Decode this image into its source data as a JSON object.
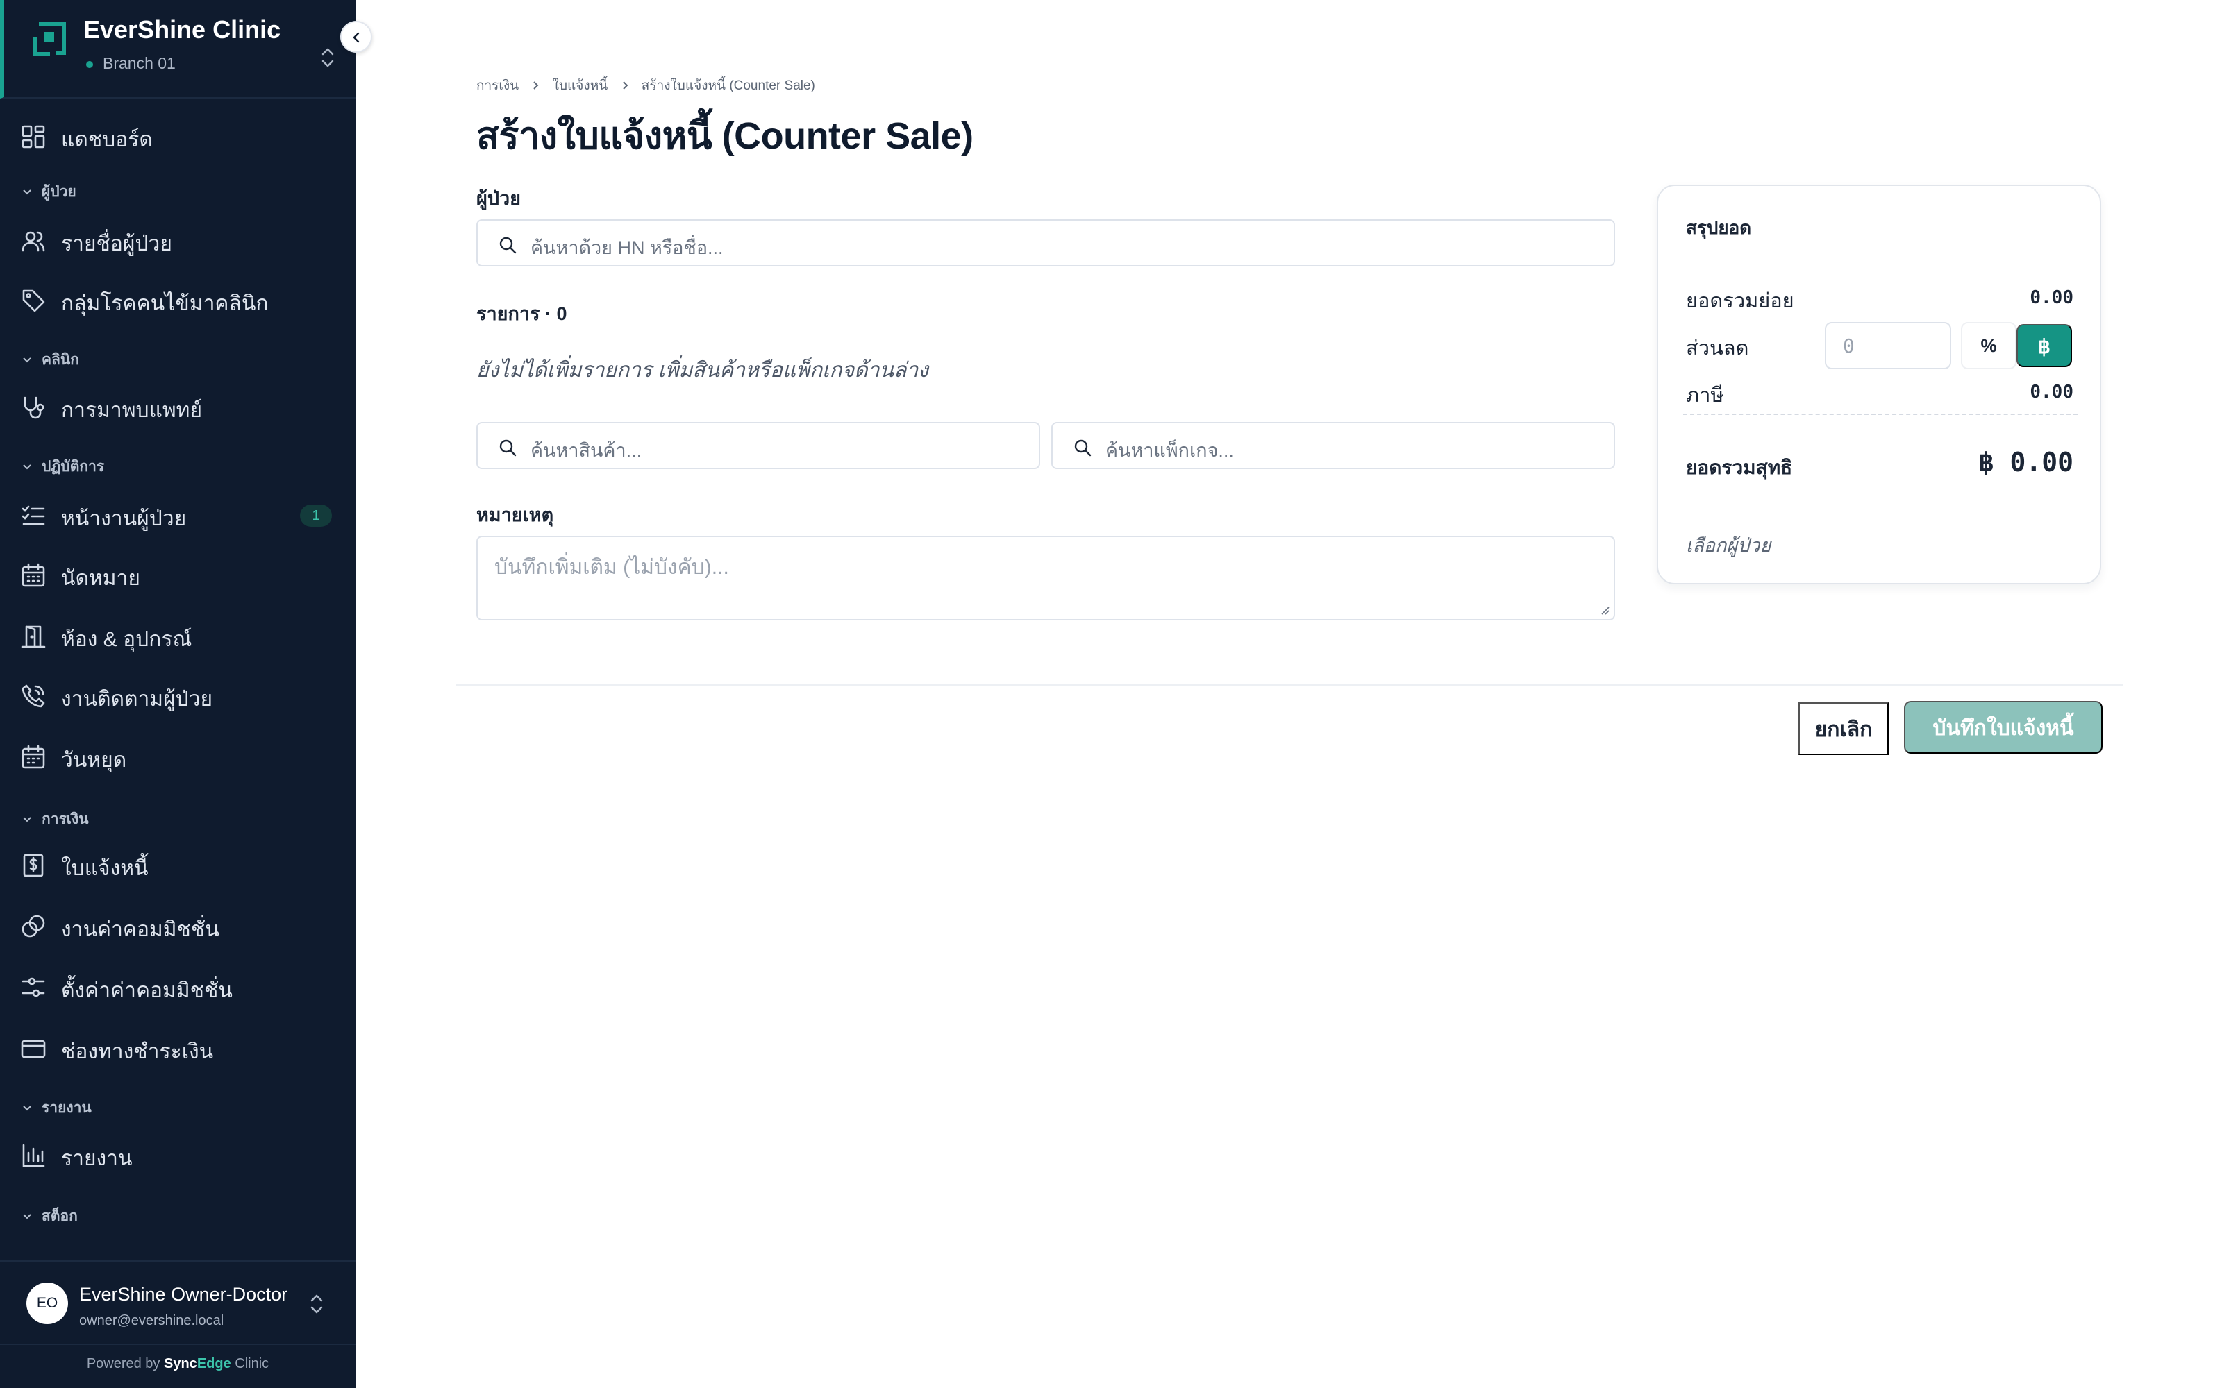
{
  "sidebar": {
    "brand": {
      "name": "EverShine Clinic",
      "branch": "Branch 01"
    },
    "items": [
      {
        "label": "แดชบอร์ด",
        "icon": "dashboard-grid-icon"
      },
      {
        "label": "รายชื่อผู้ป่วย",
        "icon": "users-icon"
      },
      {
        "label": "กลุ่มโรคคนไข้มาคลินิก",
        "icon": "tag-icon"
      },
      {
        "label": "การมาพบแพทย์",
        "icon": "stethoscope-icon"
      },
      {
        "label": "หน้างานผู้ป่วย",
        "icon": "list-checks-icon",
        "badge": "1"
      },
      {
        "label": "นัดหมาย",
        "icon": "calendar-icon"
      },
      {
        "label": "ห้อง & อุปกรณ์",
        "icon": "door-icon"
      },
      {
        "label": "งานติดตามผู้ป่วย",
        "icon": "phone-icon"
      },
      {
        "label": "วันหยุด",
        "icon": "calendar-days-icon"
      },
      {
        "label": "ใบแจ้งหนี้",
        "icon": "receipt-icon"
      },
      {
        "label": "งานค่าคอมมิชชั่น",
        "icon": "coins-icon"
      },
      {
        "label": "ตั้งค่าค่าคอมมิชชั่น",
        "icon": "sliders-icon"
      },
      {
        "label": "ช่องทางชำระเงิน",
        "icon": "credit-card-icon"
      },
      {
        "label": "รายงาน",
        "icon": "bar-chart-icon"
      }
    ],
    "sections": [
      "ผู้ป่วย",
      "คลินิก",
      "ปฏิบัติการ",
      "การเงิน",
      "รายงาน",
      "สต็อก"
    ],
    "user": {
      "initials": "EO",
      "name": "EverShine Owner-Doctor",
      "email": "owner@evershine.local"
    },
    "powered": {
      "prefix": "Powered by",
      "brand_a": "Sync",
      "brand_b": "Edge",
      "suffix": "Clinic"
    }
  },
  "main": {
    "breadcrumb": [
      "การเงิน",
      "ใบแจ้งหนี้",
      "สร้างใบแจ้งหนี้ (Counter Sale)"
    ],
    "title": "สร้างใบแจ้งหนี้ (Counter Sale)",
    "patient_label": "ผู้ป่วย",
    "patient_search_placeholder": "ค้นหาด้วย HN หรือชื่อ...",
    "items_label": "รายการ · 0",
    "empty_message": "ยังไม่ได้เพิ่มรายการ เพิ่มสินค้าหรือแพ็กเกจด้านล่าง",
    "product_search_placeholder": "ค้นหาสินค้า...",
    "package_search_placeholder": "ค้นหาแพ็กเกจ...",
    "notes_label": "หมายเหตุ",
    "notes_placeholder": "บันทึกเพิ่มเติม (ไม่บังคับ)..."
  },
  "summary": {
    "title": "สรุปยอด",
    "subtotal_label": "ยอดรวมย่อย",
    "subtotal_value": "0.00",
    "discount_label": "ส่วนลด",
    "discount_placeholder": "0",
    "discount_pct": "%",
    "discount_baht": "฿",
    "tax_label": "ภาษี",
    "tax_value": "0.00",
    "net_label": "ยอดรวมสุทธิ",
    "net_value": "฿ 0.00",
    "hint": "เลือกผู้ป่วย"
  },
  "actions": {
    "cancel": "ยกเลิก",
    "save": "บันทึกใบแจ้งหนี้"
  },
  "colors": {
    "sidebar_bg": "#0f1b2e",
    "accent": "#159484",
    "save_disabled": "#8cc2bb"
  }
}
